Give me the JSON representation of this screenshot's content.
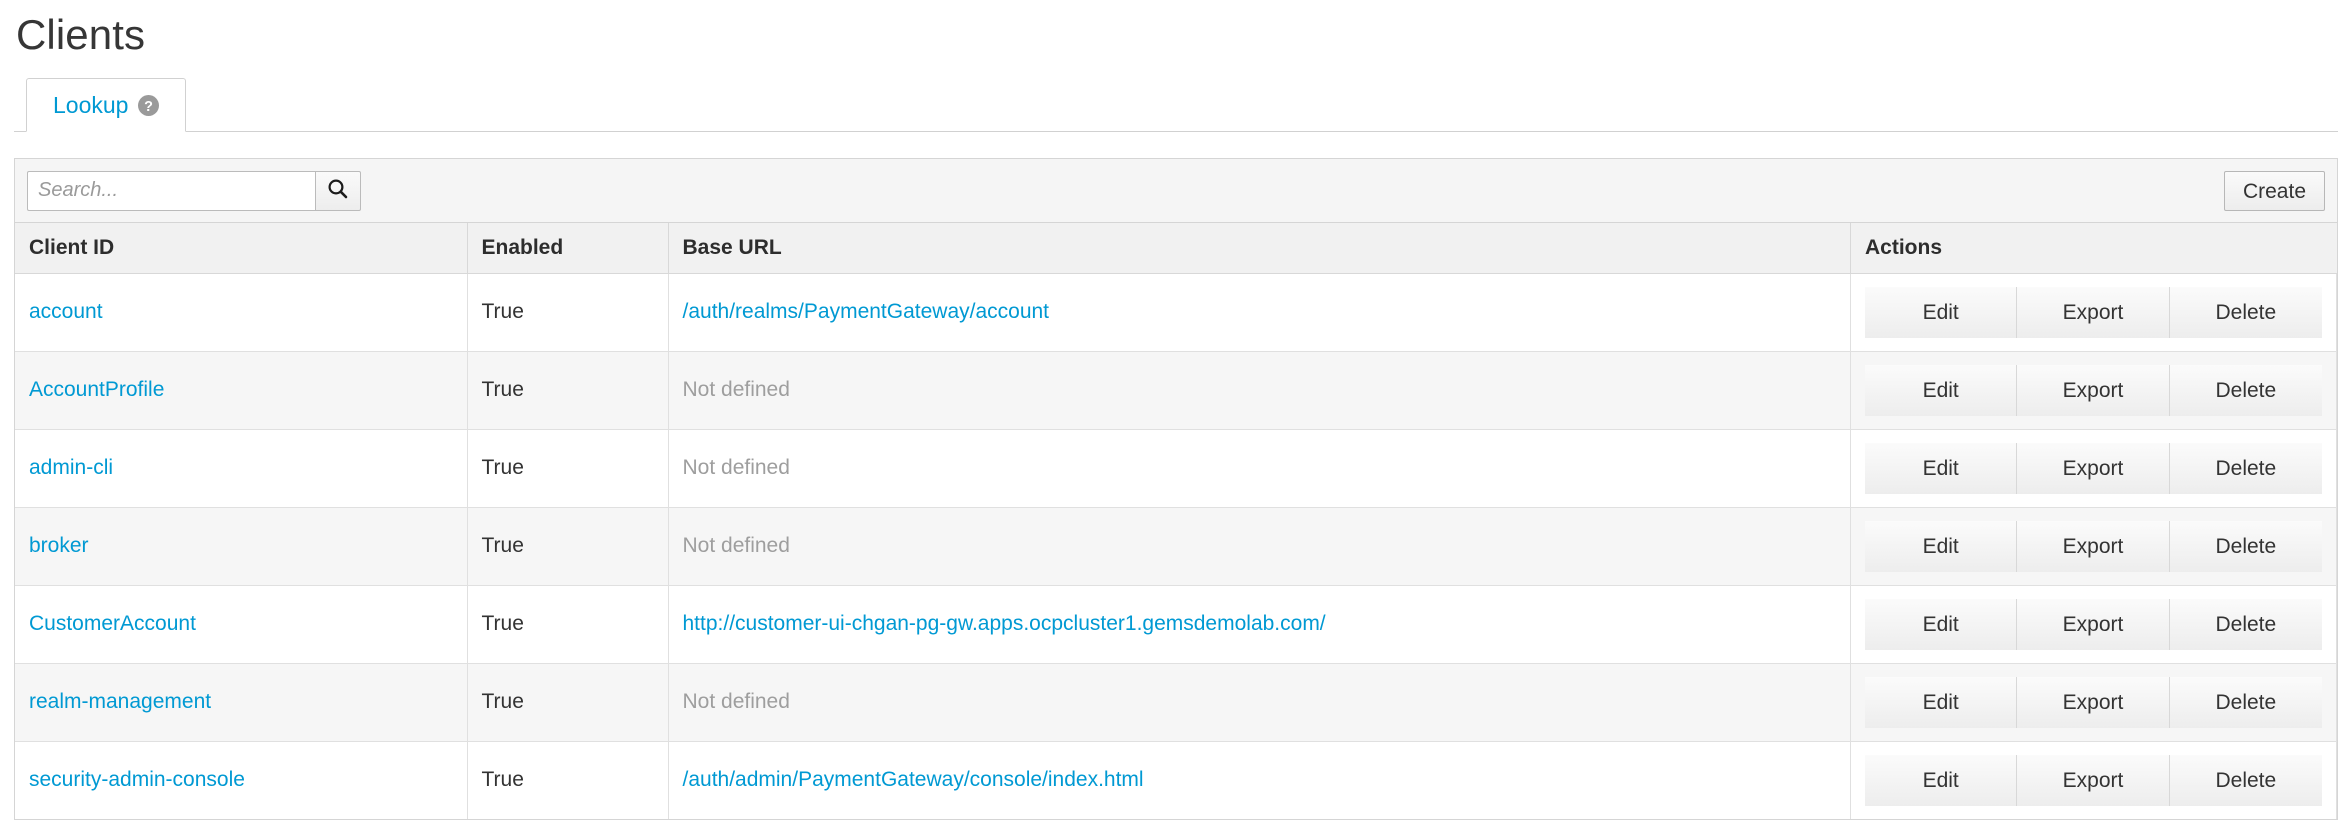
{
  "page": {
    "title": "Clients"
  },
  "tabs": [
    {
      "label": "Lookup",
      "icon": "help-circle-icon",
      "active": true
    }
  ],
  "toolbar": {
    "search_placeholder": "Search...",
    "search_value": "",
    "search_icon": "search-icon",
    "create_label": "Create"
  },
  "table": {
    "columns": [
      "Client ID",
      "Enabled",
      "Base URL",
      "Actions"
    ],
    "not_defined_text": "Not defined",
    "actions": [
      "Edit",
      "Export",
      "Delete"
    ],
    "rows": [
      {
        "client_id": "account",
        "enabled": "True",
        "base_url": "/auth/realms/PaymentGateway/account",
        "base_url_defined": true
      },
      {
        "client_id": "AccountProfile",
        "enabled": "True",
        "base_url": "Not defined",
        "base_url_defined": false
      },
      {
        "client_id": "admin-cli",
        "enabled": "True",
        "base_url": "Not defined",
        "base_url_defined": false
      },
      {
        "client_id": "broker",
        "enabled": "True",
        "base_url": "Not defined",
        "base_url_defined": false
      },
      {
        "client_id": "CustomerAccount",
        "enabled": "True",
        "base_url": "http://customer-ui-chgan-pg-gw.apps.ocpcluster1.gemsdemolab.com/",
        "base_url_defined": true
      },
      {
        "client_id": "realm-management",
        "enabled": "True",
        "base_url": "Not defined",
        "base_url_defined": false
      },
      {
        "client_id": "security-admin-console",
        "enabled": "True",
        "base_url": "/auth/admin/PaymentGateway/console/index.html",
        "base_url_defined": true
      }
    ]
  },
  "colors": {
    "link": "#0099d3",
    "text": "#333333",
    "muted": "#9e9e9e",
    "panel_border": "#d5d5d5",
    "header_bg": "#f1f1f1",
    "stripe_bg": "#f6f6f6"
  }
}
